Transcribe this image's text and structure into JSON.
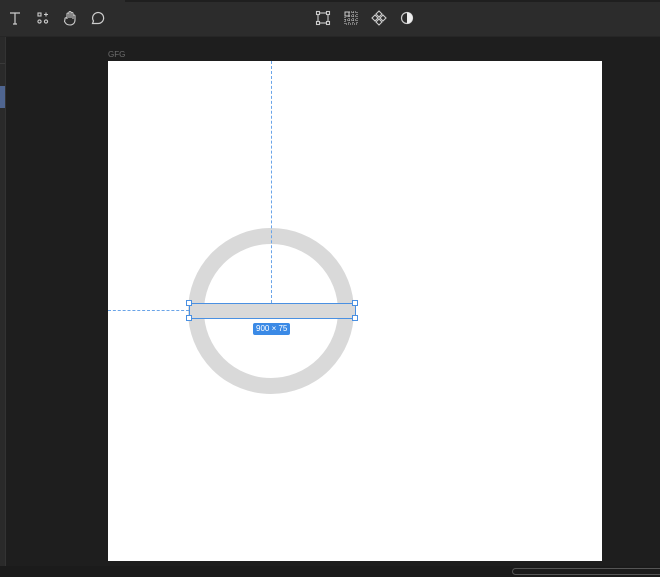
{
  "toolbar": {
    "left_tools": [
      "text-tool",
      "components-tool",
      "hand-tool",
      "comment-tool"
    ],
    "right_tools": [
      "frame-selection",
      "layout-grid",
      "component",
      "contrast-mode"
    ]
  },
  "canvas": {
    "frame_name": "GFG",
    "selection_size": "900 × 75",
    "colors": {
      "shape": "#d9d9d9",
      "selection": "#4a90e2",
      "badge": "#3b8ae6"
    }
  }
}
